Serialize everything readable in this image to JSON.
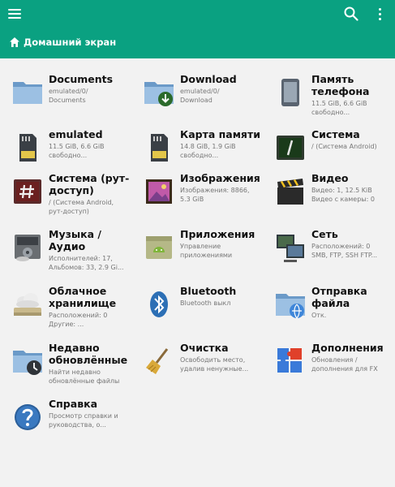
{
  "toolbar": {
    "menu_icon": "hamburger-menu-icon",
    "search_icon": "search-icon",
    "more_icon": "more-vertical-icon",
    "background": "#0aa181"
  },
  "breadcrumb": {
    "icon": "home-icon",
    "label": "Домашний экран"
  },
  "items": [
    {
      "title": "Documents",
      "subtitle": "emulated/0/\nDocuments",
      "icon": "folder-icon"
    },
    {
      "title": "Download",
      "subtitle": "emulated/0/\nDownload",
      "icon": "download-folder-icon"
    },
    {
      "title": "Память\nтелефона",
      "subtitle": "11.5 GiB, 6.6 GiB\nсвободно...",
      "icon": "phone-icon"
    },
    {
      "title": "emulated",
      "subtitle": "11.5 GiB, 6.6 GiB\nсвободно...",
      "icon": "sd-card-icon"
    },
    {
      "title": "Карта памяти",
      "subtitle": "14.8 GiB, 1.9 GiB\nсвободно...",
      "icon": "sd-card-icon"
    },
    {
      "title": "Система",
      "subtitle": "/ (Система Android)",
      "icon": "terminal-icon"
    },
    {
      "title": "Система (рут-\nдоступ)",
      "subtitle": "/ (Система Android,\nрут-доступ)",
      "icon": "root-terminal-icon"
    },
    {
      "title": "Изображения",
      "subtitle": "Изображения: 8866,\n5.3 GiB",
      "icon": "image-icon"
    },
    {
      "title": "Видео",
      "subtitle": "Видео: 1, 12.5 KiB\nВидео с камеры: 0",
      "icon": "clapperboard-icon"
    },
    {
      "title": "Музыка /\nАудио",
      "subtitle": "Исполнителей: 17,\nАльбомов: 33, 2.9 Gi...",
      "icon": "music-player-icon"
    },
    {
      "title": "Приложения",
      "subtitle": "Управление\nприложениями",
      "icon": "android-apps-icon"
    },
    {
      "title": "Сеть",
      "subtitle": "Расположений: 0\nSMB, FTP, SSH FTP...",
      "icon": "network-icon"
    },
    {
      "title": "Облачное\nхранилище",
      "subtitle": "Расположений: 0\nДругие: ...",
      "icon": "cloud-icon"
    },
    {
      "title": "Bluetooth",
      "subtitle": "Bluetooth выкл",
      "icon": "bluetooth-icon"
    },
    {
      "title": "Отправка\nфайла",
      "subtitle": "Отк.",
      "icon": "send-file-icon"
    },
    {
      "title": "Недавно\nобновлённые",
      "subtitle": "Найти недавно\nобновлённые файлы",
      "icon": "recent-files-icon"
    },
    {
      "title": "Очистка",
      "subtitle": "Освободить место,\nудалив ненужные...",
      "icon": "broom-icon"
    },
    {
      "title": "Дополнения",
      "subtitle": "Обновления / дополнения для FX",
      "icon": "puzzle-icon"
    },
    {
      "title": "Справка",
      "subtitle": "Просмотр справки и\nруководства, о...",
      "icon": "help-icon"
    }
  ]
}
